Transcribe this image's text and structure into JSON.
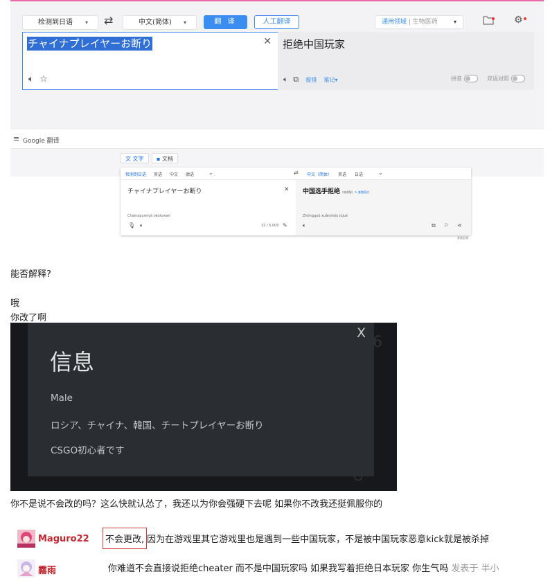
{
  "youdao": {
    "source_lang": "检测到日语",
    "target_lang": "中文(简体)",
    "translate_button": "翻 译",
    "human_translate_button": "人工翻译",
    "domain_label": "通用领域",
    "domain_value": "生物医药",
    "source_text": "チャイナプレイヤーお断り",
    "target_text": "拒绝中国玩家",
    "report_link": "报错",
    "notes_link": "笔记",
    "pinyin_label": "拼音",
    "bilingual_label": "双语对照",
    "colors": {
      "accent": "#3b8ef0",
      "top_border": "#e86aa8"
    }
  },
  "google": {
    "app_name": "Google 翻译",
    "tab_text": "文字",
    "tab_docs": "文档",
    "src_tabs": [
      "检测到日语",
      "英语",
      "中文",
      "德语"
    ],
    "tgt_tabs": [
      "中文（简体）",
      "英语",
      "日语"
    ],
    "source_text": "チャイナプレイヤーお断り",
    "source_romaji": "Chainapureiyā okotowari",
    "char_count": "12 / 5,000",
    "target_text": "中国选手拒绝",
    "target_tag": "(修改版)",
    "target_edit": "查看原文",
    "target_pinyin": "Zhōngguó xuǎnshǒu jùjué",
    "feedback": "发送反馈"
  },
  "forum": {
    "q1": "能否解释?",
    "q2": "哦",
    "q3": "你改了啊",
    "after_dialog": "你不是说不会改的吗？这么快就认怂了，我还以为你会强硬下去呢 如果你不改我还挺佩服你的"
  },
  "dialog": {
    "title": "信息",
    "line1": "Male",
    "line2": "ロシア、チャイナ、韓国、チートプレイヤーお断り",
    "line3": "CSGO初心者です",
    "close": "X"
  },
  "comments": [
    {
      "user": "Maguro22",
      "highlight": "不会更改,",
      "text": "因为在游戏里其它游戏里也是遇到一些中国玩家，不是被中国玩家恶意kick就是被杀掉"
    },
    {
      "user": "霧雨",
      "text": "你难道不会直接说拒绝cheater 而不是中国玩家吗 如果我写着拒绝日本玩家 你生气吗",
      "meta": "发表于 半小"
    }
  ]
}
